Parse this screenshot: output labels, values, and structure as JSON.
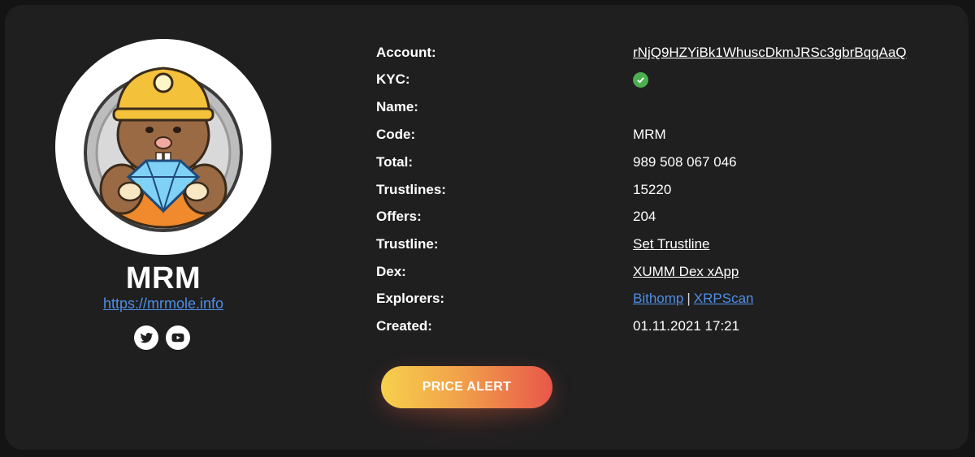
{
  "token": {
    "title": "MRM",
    "website": "https://mrmole.info"
  },
  "socials": [
    {
      "icon": "twitter-icon"
    },
    {
      "icon": "youtube-icon"
    }
  ],
  "details": {
    "account_label": "Account:",
    "account_value": "rNjQ9HZYiBk1WhuscDkmJRSc3gbrBqqAaQ",
    "kyc_label": "KYC:",
    "kyc_icon": "check-icon",
    "name_label": "Name:",
    "name_value": "",
    "code_label": "Code:",
    "code_value": "MRM",
    "total_label": "Total:",
    "total_value": "989 508 067 046",
    "trustlines_label": "Trustlines:",
    "trustlines_value": "15220",
    "offers_label": "Offers:",
    "offers_value": "204",
    "trustline_label": "Trustline:",
    "trustline_link": "Set Trustline",
    "dex_label": "Dex:",
    "dex_link": "XUMM Dex xApp",
    "explorers_label": "Explorers:",
    "explorer_1": "Bithomp",
    "explorer_sep": "|",
    "explorer_2": "XRPScan",
    "created_label": "Created:",
    "created_value": "01.11.2021 17:21"
  },
  "actions": {
    "price_alert": "PRICE ALERT"
  },
  "colors": {
    "link": "#4f8fe6",
    "kyc_ok": "#4caf50",
    "button_start": "#f7d04c",
    "button_end": "#e8574a"
  }
}
